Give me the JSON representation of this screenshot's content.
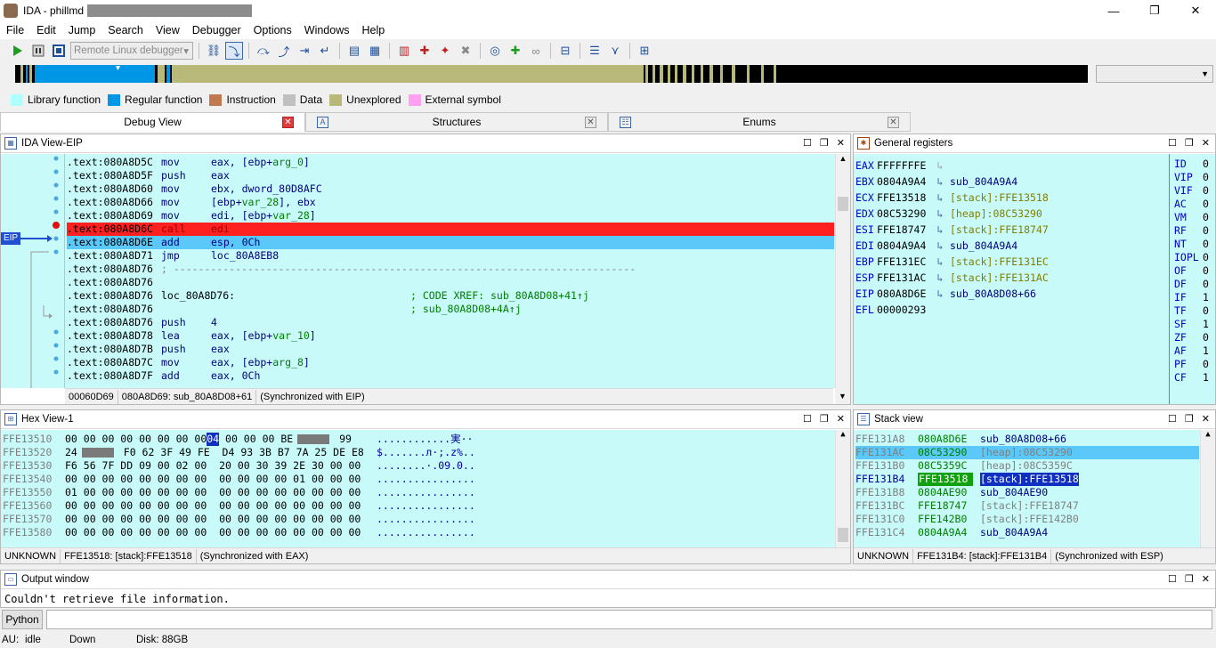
{
  "window": {
    "title": "IDA - phillmd",
    "minimize": "—",
    "maximize": "❐",
    "close": "✕"
  },
  "menu": [
    "File",
    "Edit",
    "Jump",
    "Search",
    "View",
    "Debugger",
    "Options",
    "Windows",
    "Help"
  ],
  "toolbar": {
    "debugger_select": "Remote Linux debugger"
  },
  "legend": [
    {
      "label": "Library function",
      "color": "#b0ffff"
    },
    {
      "label": "Regular function",
      "color": "#0096e6"
    },
    {
      "label": "Instruction",
      "color": "#c07850"
    },
    {
      "label": "Data",
      "color": "#c0c0c0"
    },
    {
      "label": "Unexplored",
      "color": "#b8b878"
    },
    {
      "label": "External symbol",
      "color": "#ffa0f0"
    }
  ],
  "tabs": [
    {
      "label": "Debug View"
    },
    {
      "label": "Structures"
    },
    {
      "label": "Enums"
    }
  ],
  "ida_view": {
    "title": "IDA View-EIP",
    "eip_label": "EIP",
    "lines": [
      {
        "addr": ".text:080A8D5C",
        "mn": "mov",
        "op": "eax, [ebp+",
        "var": "arg_0",
        "tail": "]"
      },
      {
        "addr": ".text:080A8D5F",
        "mn": "push",
        "op": "eax",
        "var": "",
        "tail": ""
      },
      {
        "addr": ".text:080A8D60",
        "mn": "mov",
        "op": "ebx, dword_80D8AFC",
        "var": "",
        "tail": ""
      },
      {
        "addr": ".text:080A8D66",
        "mn": "mov",
        "op": "[ebp+",
        "var": "var_28",
        "tail": "], ebx"
      },
      {
        "addr": ".text:080A8D69",
        "mn": "mov",
        "op": "edi, [ebp+",
        "var": "var_28",
        "tail": "]"
      },
      {
        "addr": ".text:080A8D6C",
        "mn": "call",
        "op": "edi",
        "var": "",
        "tail": ""
      },
      {
        "addr": ".text:080A8D6E",
        "mn": "add",
        "op": "esp, 0Ch",
        "var": "",
        "tail": ""
      },
      {
        "addr": ".text:080A8D71",
        "mn": "jmp",
        "op": "loc_80A8EB8",
        "var": "",
        "tail": ""
      },
      {
        "addr": ".text:080A8D76",
        "mn": "; ---------------------------------------------------------------------------",
        "op": "",
        "var": "",
        "tail": ""
      },
      {
        "addr": ".text:080A8D76",
        "mn": "",
        "op": "",
        "var": "",
        "tail": ""
      },
      {
        "addr": ".text:080A8D76",
        "mn": "loc_80A8D76:",
        "op": "",
        "var": "",
        "tail": "",
        "comment": "; CODE XREF: sub_80A8D08+41↑j"
      },
      {
        "addr": ".text:080A8D76",
        "mn": "",
        "op": "",
        "var": "",
        "tail": "",
        "comment": "; sub_80A8D08+4A↑j"
      },
      {
        "addr": ".text:080A8D76",
        "mn": "push",
        "op": "4",
        "var": "",
        "tail": ""
      },
      {
        "addr": ".text:080A8D78",
        "mn": "lea",
        "op": "eax, [ebp+",
        "var": "var_10",
        "tail": "]"
      },
      {
        "addr": ".text:080A8D7B",
        "mn": "push",
        "op": "eax",
        "var": "",
        "tail": ""
      },
      {
        "addr": ".text:080A8D7C",
        "mn": "mov",
        "op": "eax, [ebp+",
        "var": "arg_8",
        "tail": "]"
      },
      {
        "addr": ".text:080A8D7F",
        "mn": "add",
        "op": "eax, 0Ch",
        "var": "",
        "tail": ""
      }
    ],
    "status": [
      "00060D69",
      "080A8D69: sub_80A8D08+61",
      "(Synchronized with EIP)"
    ]
  },
  "registers": {
    "title": "General registers",
    "rows": [
      {
        "name": "EAX",
        "value": "FFFFFFFE",
        "ref": ""
      },
      {
        "name": "EBX",
        "value": "0804A9A4",
        "ref": "sub_804A9A4"
      },
      {
        "name": "ECX",
        "value": "FFE13518",
        "ref": "[stack]:FFE13518"
      },
      {
        "name": "EDX",
        "value": "08C53290",
        "ref": "[heap]:08C53290"
      },
      {
        "name": "ESI",
        "value": "FFE18747",
        "ref": "[stack]:FFE18747"
      },
      {
        "name": "EDI",
        "value": "0804A9A4",
        "ref": "sub_804A9A4"
      },
      {
        "name": "EBP",
        "value": "FFE131EC",
        "ref": "[stack]:FFE131EC"
      },
      {
        "name": "ESP",
        "value": "FFE131AC",
        "ref": "[stack]:FFE131AC"
      },
      {
        "name": "EIP",
        "value": "080A8D6E",
        "ref": "sub_80A8D08+66"
      },
      {
        "name": "EFL",
        "value": "00000293",
        "ref": ""
      }
    ],
    "flags": [
      {
        "name": "ID",
        "value": "0"
      },
      {
        "name": "VIP",
        "value": "0"
      },
      {
        "name": "VIF",
        "value": "0"
      },
      {
        "name": "AC",
        "value": "0"
      },
      {
        "name": "VM",
        "value": "0"
      },
      {
        "name": "RF",
        "value": "0"
      },
      {
        "name": "NT",
        "value": "0"
      },
      {
        "name": "IOPL",
        "value": "0"
      },
      {
        "name": "OF",
        "value": "0"
      },
      {
        "name": "DF",
        "value": "0"
      },
      {
        "name": "IF",
        "value": "1"
      },
      {
        "name": "TF",
        "value": "0"
      },
      {
        "name": "SF",
        "value": "1"
      },
      {
        "name": "ZF",
        "value": "0"
      },
      {
        "name": "AF",
        "value": "1"
      },
      {
        "name": "PF",
        "value": "0"
      },
      {
        "name": "CF",
        "value": "1"
      }
    ]
  },
  "hex_view": {
    "title": "Hex View-1",
    "rows": [
      {
        "addr": "FFE13510",
        "bytes": "00 00 00 00 00 00 00 00",
        "sel": "04",
        "bytes2": " 00 00 00 BE",
        "redact": true,
        "bytes3": " 99",
        "ascii": "............実··"
      },
      {
        "addr": "FFE13520",
        "bytes": "24",
        "sel": "",
        "bytes2": "",
        "redact": true,
        "bytes3": " F0 62 3F 49 FE  D4 93 3B B7 7A 25 DE E8",
        "ascii": "$.......л·;.z%.."
      },
      {
        "addr": "FFE13530",
        "bytes": "F6 56 7F DD 09 00 02 00  20 00 30 39 2E 30 00 00",
        "sel": "",
        "bytes2": "",
        "redact": false,
        "bytes3": "",
        "ascii": "........·.09.0.."
      },
      {
        "addr": "FFE13540",
        "bytes": "00 00 00 00 00 00 00 00  00 00 00 00 01 00 00 00",
        "sel": "",
        "bytes2": "",
        "redact": false,
        "bytes3": "",
        "ascii": "................"
      },
      {
        "addr": "FFE13550",
        "bytes": "01 00 00 00 00 00 00 00  00 00 00 00 00 00 00 00",
        "sel": "",
        "bytes2": "",
        "redact": false,
        "bytes3": "",
        "ascii": "................"
      },
      {
        "addr": "FFE13560",
        "bytes": "00 00 00 00 00 00 00 00  00 00 00 00 00 00 00 00",
        "sel": "",
        "bytes2": "",
        "redact": false,
        "bytes3": "",
        "ascii": "................"
      },
      {
        "addr": "FFE13570",
        "bytes": "00 00 00 00 00 00 00 00  00 00 00 00 00 00 00 00",
        "sel": "",
        "bytes2": "",
        "redact": false,
        "bytes3": "",
        "ascii": "................"
      },
      {
        "addr": "FFE13580",
        "bytes": "00 00 00 00 00 00 00 00  00 00 00 00 00 00 00 00",
        "sel": "",
        "bytes2": "",
        "redact": false,
        "bytes3": "",
        "ascii": "................"
      }
    ],
    "status": [
      "UNKNOWN",
      "FFE13518: [stack]:FFE13518",
      "(Synchronized with EAX)"
    ]
  },
  "stack_view": {
    "title": "Stack view",
    "rows": [
      {
        "addr": "FFE131A8",
        "value": "080A8D6E",
        "ref": "sub_80A8D08+66"
      },
      {
        "addr": "FFE131AC",
        "value": "08C53290",
        "ref": "[heap]:08C53290"
      },
      {
        "addr": "FFE131B0",
        "value": "08C5359C",
        "ref": "[heap]:08C5359C"
      },
      {
        "addr": "FFE131B4",
        "value": "FFE13518",
        "ref": "[stack]:FFE13518"
      },
      {
        "addr": "FFE131B8",
        "value": "0804AE90",
        "ref": "sub_804AE90"
      },
      {
        "addr": "FFE131BC",
        "value": "FFE18747",
        "ref": "[stack]:FFE18747"
      },
      {
        "addr": "FFE131C0",
        "value": "FFE142B0",
        "ref": "[stack]:FFE142B0"
      },
      {
        "addr": "FFE131C4",
        "value": "0804A9A4",
        "ref": "sub_804A9A4"
      }
    ],
    "status": [
      "UNKNOWN",
      "FFE131B4: [stack]:FFE131B4",
      "(Synchronized with ESP)"
    ]
  },
  "output": {
    "title": "Output window",
    "text": "Couldn't retrieve file information."
  },
  "python_button": "Python",
  "statusbar": {
    "au": "AU:",
    "au_state": "idle",
    "direction": "Down",
    "disk": "Disk: 88GB"
  }
}
